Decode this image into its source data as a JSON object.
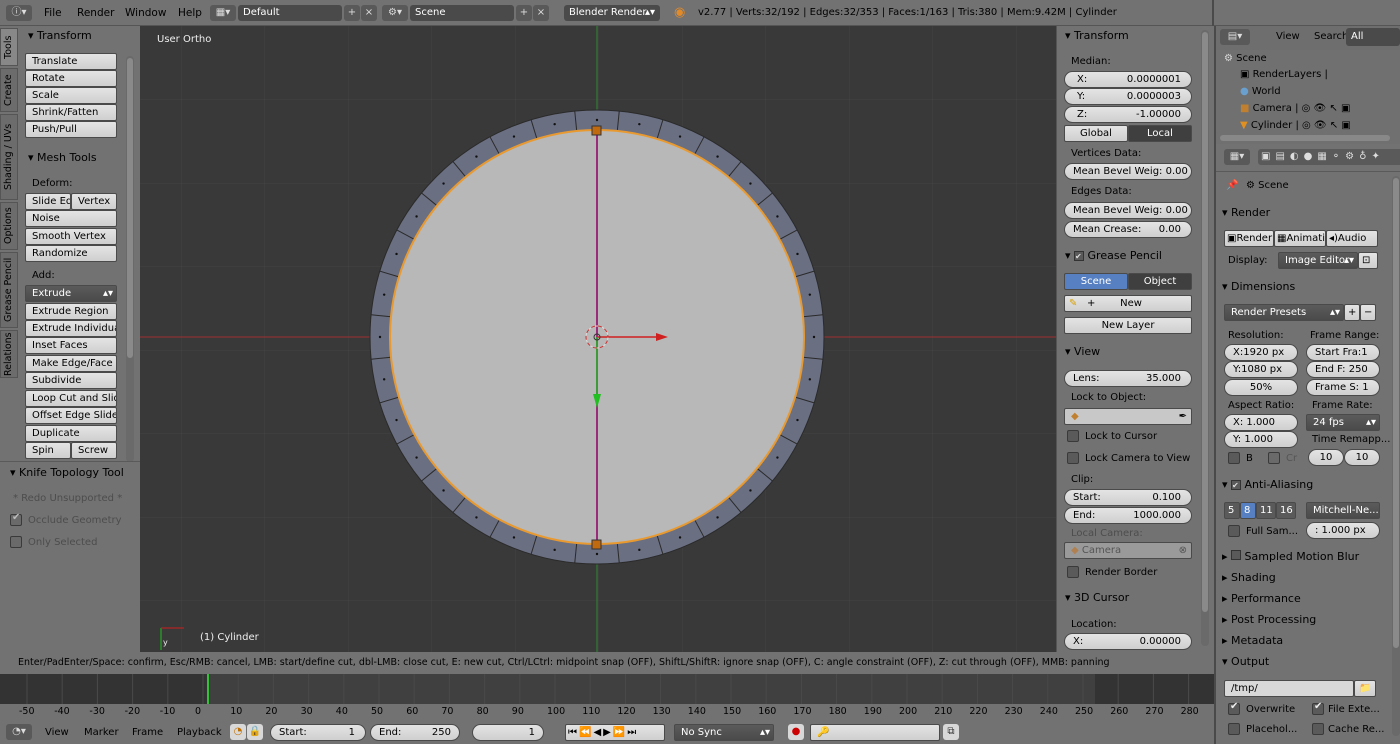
{
  "topbar": {
    "menus": [
      "File",
      "Render",
      "Window",
      "Help"
    ],
    "layout": "Default",
    "scene": "Scene",
    "engine": "Blender Render",
    "stats": "v2.77 | Verts:32/192 | Edges:32/353 | Faces:1/163 | Tris:380 | Mem:9.42M | Cylinder"
  },
  "tool_tabs": [
    "Tools",
    "Create",
    "Shading / UVs",
    "Options",
    "Grease Pencil",
    "Relations"
  ],
  "transform_panel": {
    "title": "Transform",
    "buttons": [
      "Translate",
      "Rotate",
      "Scale",
      "Shrink/Fatten",
      "Push/Pull"
    ]
  },
  "mesh_tools": {
    "title": "Mesh Tools",
    "deform_label": "Deform:",
    "slide_edge": "Slide Ed",
    "vertex": "Vertex",
    "noise": "Noise",
    "smooth_vertex": "Smooth Vertex",
    "randomize": "Randomize",
    "add_label": "Add:",
    "extrude": "Extrude",
    "add_buttons": [
      "Extrude Region",
      "Extrude Individual",
      "Inset Faces",
      "Make Edge/Face",
      "Subdivide",
      "Loop Cut and Slide",
      "Offset Edge Slide",
      "Duplicate"
    ],
    "spin": "Spin",
    "screw": "Screw"
  },
  "knife_panel": {
    "title": "Knife Topology Tool",
    "redo": "* Redo Unsupported *",
    "occlude": "Occlude Geometry",
    "only_selected": "Only Selected"
  },
  "viewport": {
    "view_name": "User Ortho",
    "object_label": "(1) Cylinder",
    "axis_y": "y"
  },
  "properties_n": {
    "transform_title": "Transform",
    "median": "Median:",
    "x_label": "X:",
    "x_val": "0.0000001",
    "y_label": "Y:",
    "y_val": "0.0000003",
    "z_label": "Z:",
    "z_val": "-1.00000",
    "global": "Global",
    "local": "Local",
    "vertices_data": "Vertices Data:",
    "mean_bevel_v": "Mean Bevel Weig: 0.00",
    "edges_data": "Edges Data:",
    "mean_bevel_e": "Mean Bevel Weig: 0.00",
    "mean_crease_label": "Mean Crease:",
    "mean_crease_val": "0.00",
    "grease_title": "Grease Pencil",
    "gp_scene": "Scene",
    "gp_object": "Object",
    "gp_new": "New",
    "gp_new_layer": "New Layer",
    "view_title": "View",
    "lens_label": "Lens:",
    "lens_val": "35.000",
    "lock_to_object": "Lock to Object:",
    "lock_cursor": "Lock to Cursor",
    "lock_camera": "Lock Camera to View",
    "clip": "Clip:",
    "start_label": "Start:",
    "start_val": "0.100",
    "end_label": "End:",
    "end_val": "1000.000",
    "local_camera": "Local Camera:",
    "camera": "Camera",
    "render_border": "Render Border",
    "cursor_title": "3D Cursor",
    "location": "Location:",
    "cx_label": "X:",
    "cx_val": "0.00000"
  },
  "outliner": {
    "view": "View",
    "search": "Search",
    "all_scenes": "All Scenes",
    "items": [
      "Scene",
      "RenderLayers",
      "World",
      "Camera",
      "Cylinder"
    ]
  },
  "render_props": {
    "scene": "Scene",
    "render_title": "Render",
    "render_btn": "Render",
    "anim_btn": "Animati",
    "audio_btn": "Audio",
    "display_label": "Display:",
    "display_val": "Image Editor",
    "dimensions": "Dimensions",
    "presets": "Render Presets",
    "resolution": "Resolution:",
    "frame_range": "Frame Range:",
    "res_x": "X:1920 px",
    "start_frame": "Start Fra:1",
    "res_y": "Y:1080 px",
    "end_frame": "End F: 250",
    "res_pct": "50%",
    "frame_step": "Frame S: 1",
    "aspect": "Aspect Ratio:",
    "frame_rate": "Frame Rate:",
    "asp_x": "X:   1.000",
    "fps": "24 fps",
    "asp_y": "Y:   1.000",
    "time_remap": "Time Remapp...",
    "b": "B",
    "cr": "Cr",
    "remap_old": "10",
    "remap_new": "10",
    "aa_title": "Anti-Aliasing",
    "aa_samples": [
      "5",
      "8",
      "11",
      "16"
    ],
    "aa_filter": "Mitchell-Ne...",
    "full_sample": "Full Sam...",
    "filter_size": ": 1.000 px",
    "motion_blur": "Sampled Motion Blur",
    "shading": "Shading",
    "performance": "Performance",
    "post": "Post Processing",
    "metadata": "Metadata",
    "output": "Output",
    "path": "/tmp/",
    "overwrite": "Overwrite",
    "file_ext": "File Exte...",
    "placeholders": "Placehol...",
    "cache": "Cache Re..."
  },
  "status": "Enter/PadEnter/Space: confirm, Esc/RMB: cancel, LMB: start/define cut, dbl-LMB: close cut, E: new cut, Ctrl/LCtrl: midpoint snap (OFF), ShiftL/ShiftR: ignore snap (OFF), C: angle constraint (OFF), Z: cut through (OFF), MMB: panning",
  "timeline": {
    "ticks": [
      "-50",
      "-40",
      "-30",
      "-20",
      "-10",
      "0",
      "10",
      "20",
      "30",
      "40",
      "50",
      "60",
      "70",
      "80",
      "90",
      "100",
      "110",
      "120",
      "130",
      "140",
      "150",
      "160",
      "170",
      "180",
      "190",
      "200",
      "210",
      "220",
      "230",
      "240",
      "250",
      "260",
      "270",
      "280"
    ],
    "current_frame": 0
  },
  "bottombar": {
    "menus": [
      "View",
      "Marker",
      "Frame",
      "Playback"
    ],
    "start_label": "Start:",
    "start_val": "1",
    "end_label": "End:",
    "end_val": "250",
    "current": "1",
    "sync": "No Sync"
  }
}
